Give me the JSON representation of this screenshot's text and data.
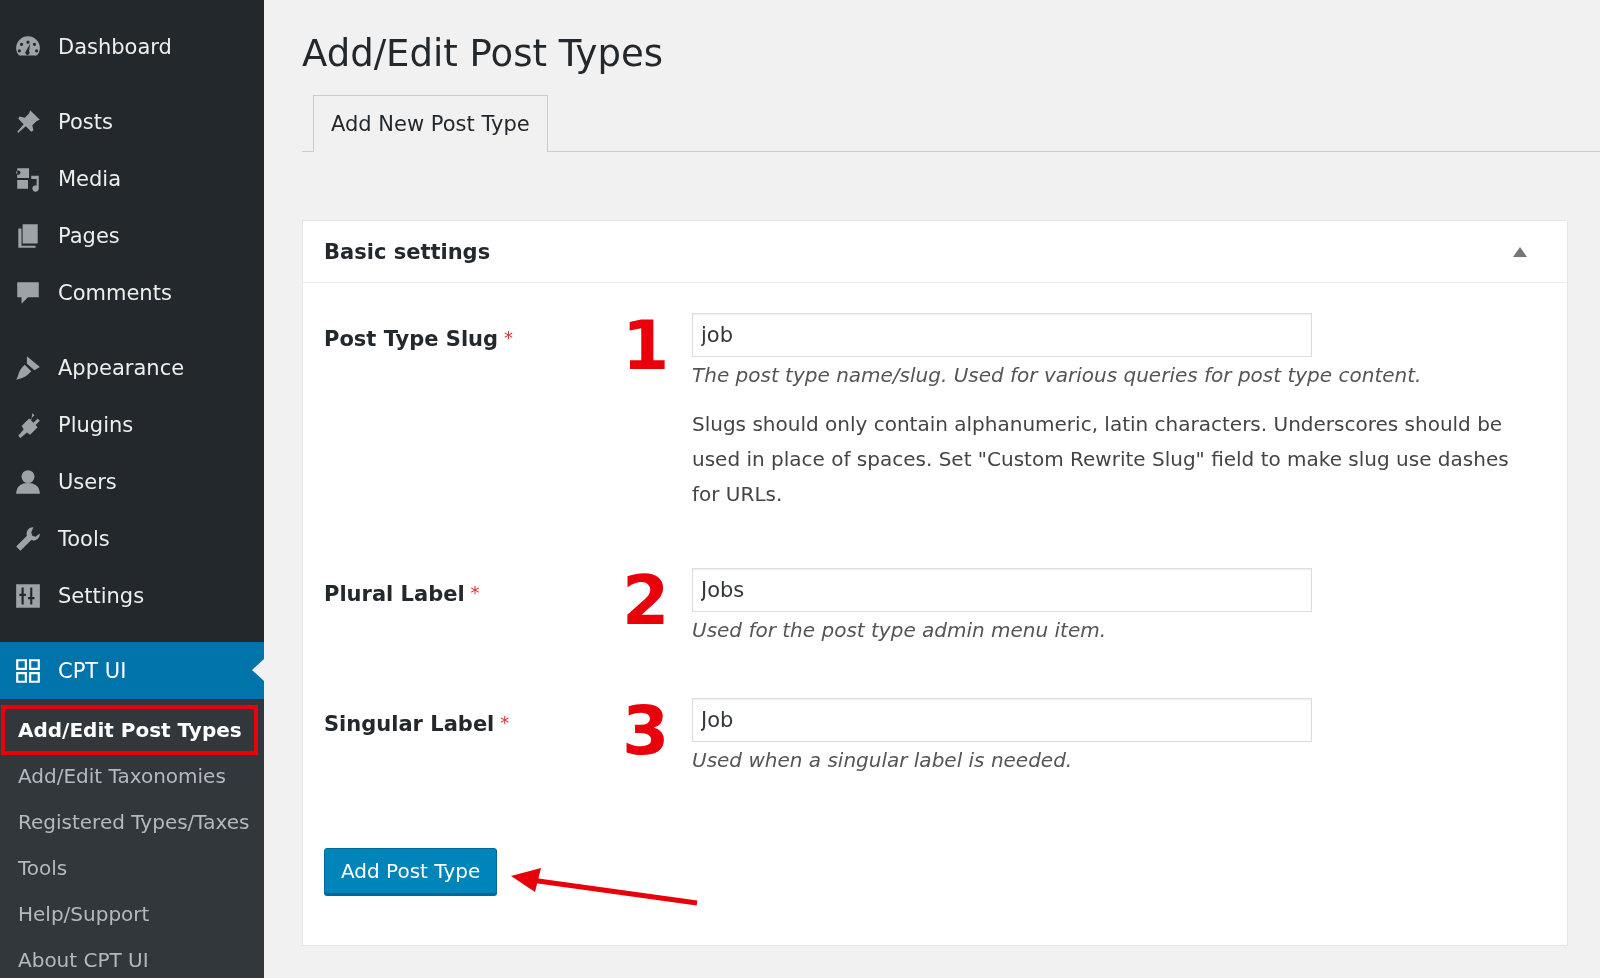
{
  "sidebar": {
    "groups": [
      {
        "items": [
          {
            "label": "Dashboard",
            "selected": false
          }
        ]
      },
      {
        "items": [
          {
            "label": "Posts",
            "selected": false
          },
          {
            "label": "Media",
            "selected": false
          },
          {
            "label": "Pages",
            "selected": false
          },
          {
            "label": "Comments",
            "selected": false
          }
        ]
      },
      {
        "items": [
          {
            "label": "Appearance",
            "selected": false
          },
          {
            "label": "Plugins",
            "selected": false
          },
          {
            "label": "Users",
            "selected": false
          },
          {
            "label": "Tools",
            "selected": false
          },
          {
            "label": "Settings",
            "selected": false
          }
        ]
      },
      {
        "items": [
          {
            "label": "CPT UI",
            "selected": true,
            "children": [
              {
                "label": "Add/Edit Post Types",
                "selected": true,
                "highlighted": true
              },
              {
                "label": "Add/Edit Taxonomies",
                "selected": false,
                "highlighted": false
              },
              {
                "label": "Registered Types/Taxes",
                "selected": false,
                "highlighted": false
              },
              {
                "label": "Tools",
                "selected": false,
                "highlighted": false
              },
              {
                "label": "Help/Support",
                "selected": false,
                "highlighted": false
              },
              {
                "label": "About CPT UI",
                "selected": false,
                "highlighted": false
              }
            ]
          }
        ]
      }
    ]
  },
  "page": {
    "title": "Add/Edit Post Types",
    "tabs": [
      {
        "label": "Add New Post Type",
        "selected": true
      }
    ],
    "panel": {
      "title": "Basic settings",
      "expanded": true,
      "fields": [
        {
          "label": "Post Type Slug",
          "required_mark": "*",
          "annotation_number": "1",
          "value": "job",
          "description": "The post type name/slug. Used for various queries for post type content.",
          "help": "Slugs should only contain alphanumeric, latin characters. Underscores should be used in place of spaces. Set \"Custom Rewrite Slug\" field to make slug use dashes for URLs."
        },
        {
          "label": "Plural Label",
          "required_mark": "*",
          "annotation_number": "2",
          "value": "Jobs",
          "description": "Used for the post type admin menu item."
        },
        {
          "label": "Singular Label",
          "required_mark": "*",
          "annotation_number": "3",
          "value": "Job",
          "description": "Used when a singular label is needed."
        }
      ],
      "submit": {
        "label": "Add Post Type",
        "annotated": true
      }
    }
  }
}
